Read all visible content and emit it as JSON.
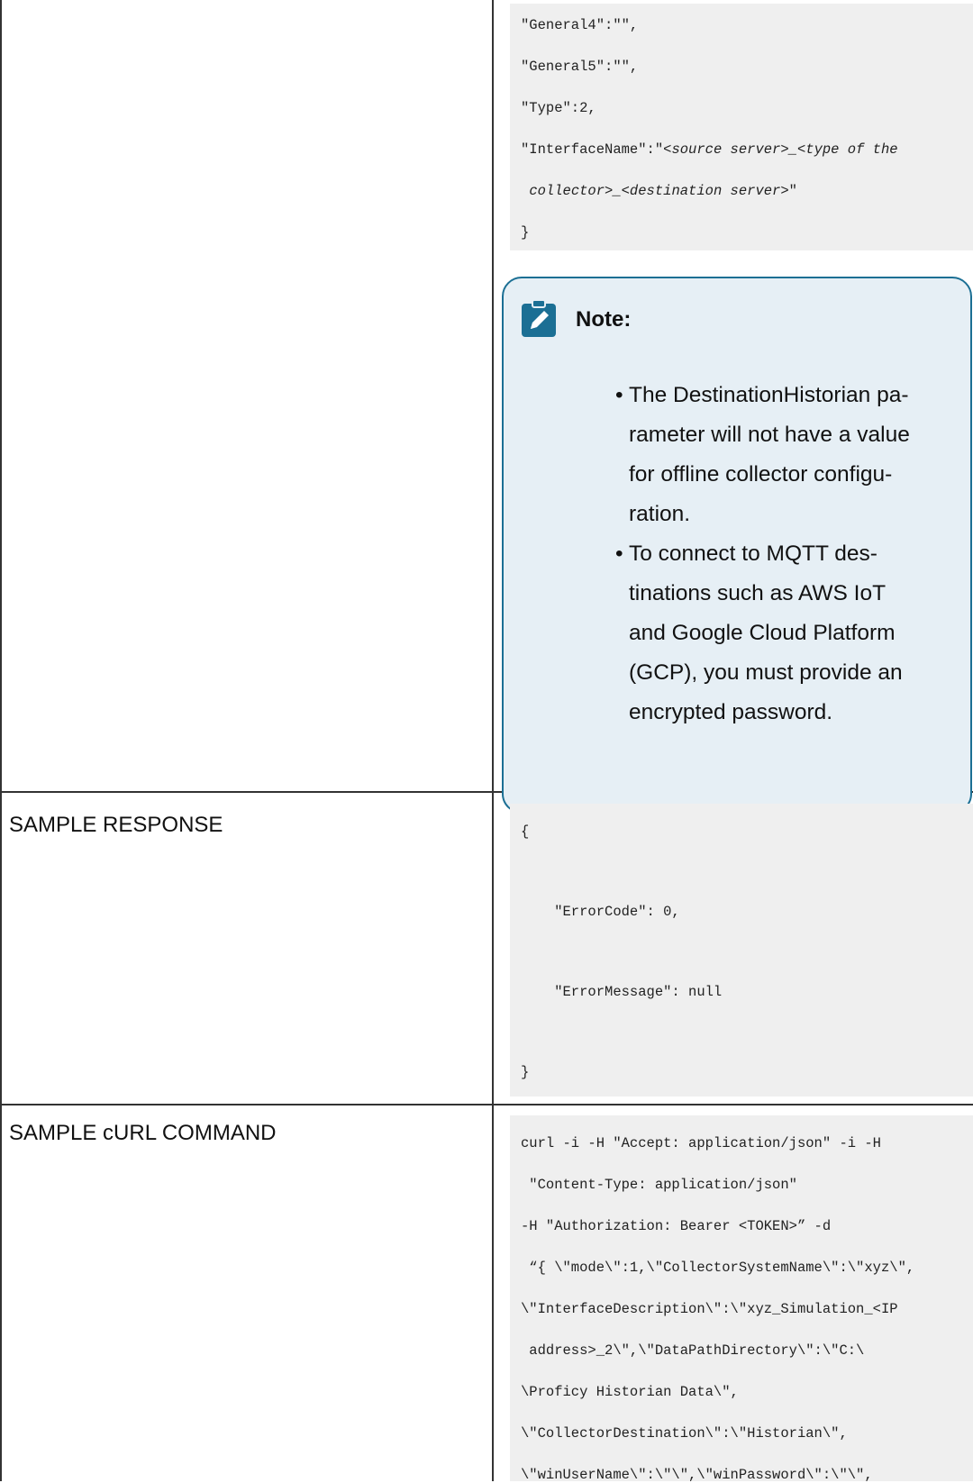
{
  "top_code": {
    "lines": [
      "\"General4\":\"\",",
      "\"General5\":\"\",",
      "\"Type\":2,"
    ],
    "interface_key": "\"InterfaceName\":\"",
    "interface_italic_1": "<source server>_<type of the",
    "interface_italic_2": "collector>_<destination server>",
    "interface_tail": "\"",
    "close_brace": "}"
  },
  "note": {
    "title": "Note:",
    "items": [
      [
        "The DestinationHistorian pa-",
        "rameter will not have a value",
        "for offline collector configu-",
        "ration."
      ],
      [
        "To connect to MQTT des-",
        "tinations such as AWS IoT",
        "and Google Cloud Platform",
        "(GCP), you must provide an",
        "encrypted password."
      ]
    ]
  },
  "sample_response": {
    "label": "SAMPLE RESPONSE",
    "lines": [
      "{",
      "    \"ErrorCode\": 0,",
      "    \"ErrorMessage\": null",
      "}"
    ]
  },
  "sample_curl": {
    "label": "SAMPLE cURL COMMAND",
    "lines": [
      "curl -i -H \"Accept: application/json\" -i -H",
      " \"Content-Type: application/json\"",
      "-H \"Authorization: Bearer <TOKEN>” -d",
      " “{ \\\"mode\\\":1,\\\"CollectorSystemName\\\":\\\"xyz\\\",",
      "\\\"InterfaceDescription\\\":\\\"xyz_Simulation_<IP",
      " address>_2\\\",\\\"DataPathDirectory\\\":\\\"C:\\",
      "\\Proficy Historian Data\\\",",
      "\\\"CollectorDestination\\\":\\\"Historian\\\",",
      "\\\"winUserName\\\":\\\"\\\",\\\"winPassword\\\":\\\"\\\","
    ]
  },
  "colors": {
    "note_border": "#1b6f94",
    "note_background": "#e6eff5",
    "note_icon": "#1b6f94",
    "code_background": "#efefef"
  }
}
